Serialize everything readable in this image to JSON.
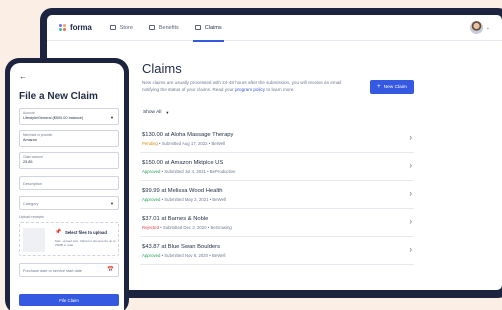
{
  "desktop": {
    "brand": "forma",
    "nav": {
      "tabs": [
        {
          "label": "Store"
        },
        {
          "label": "Benefits"
        },
        {
          "label": "Claims"
        }
      ]
    },
    "title": "Claims",
    "description": "New claims are usually processed with 24-48 hours after the submission, you will receive an email notifying the status of your claims. Read your ",
    "description_link": "program policy",
    "description_end": " to learn more.",
    "new_claim_button": "New Claim",
    "filter_label": "Show All",
    "claims": [
      {
        "title": "$130.00 at Aloha Massage Therapy",
        "status": "Pending",
        "status_color": "#d4900a",
        "submitted": "Submitted Aug 17, 2022",
        "program": "BeWell"
      },
      {
        "title": "$150.00 at Amazon Mktplce US",
        "status": "Approved",
        "status_color": "#1f9d55",
        "submitted": "Submitted Jul 4, 2021",
        "program": "BeProductive"
      },
      {
        "title": "$99.99 at Melissa Wood Health",
        "status": "Approved",
        "status_color": "#1f9d55",
        "submitted": "Submitted May 2, 2021",
        "program": "BeWell"
      },
      {
        "title": "$37.01 at Barnes & Noble",
        "status": "Rejected",
        "status_color": "#d64545",
        "submitted": "Submitted Dec 3, 2020",
        "program": "BeGrowing"
      },
      {
        "title": "$43.87 at Blue Swan Boulders",
        "status": "Approved",
        "status_color": "#1f9d55",
        "submitted": "Submitted Nov 6, 2020",
        "program": "BeWell"
      }
    ]
  },
  "mobile": {
    "title": "File a New Claim",
    "account_label": "Account",
    "account_value": "Lifestyle/General ($500.00 balance)",
    "merchant_label": "Merchant or provider",
    "merchant_value": "Amazon",
    "amount_label": "Claim amount",
    "amount_value": "25.85",
    "description_placeholder": "Description",
    "category_placeholder": "Category",
    "upload_label": "Upload receipts",
    "upload_title": "Select files to upload",
    "upload_hint": "Max. upload size: Valid per documents up to 25MB in total",
    "date_placeholder": "Purchase date or service start date",
    "file_claim_button": "File Claim"
  },
  "colors": {
    "accent": "#3559e0",
    "frame": "#1d2440",
    "background": "#fbeee4"
  }
}
